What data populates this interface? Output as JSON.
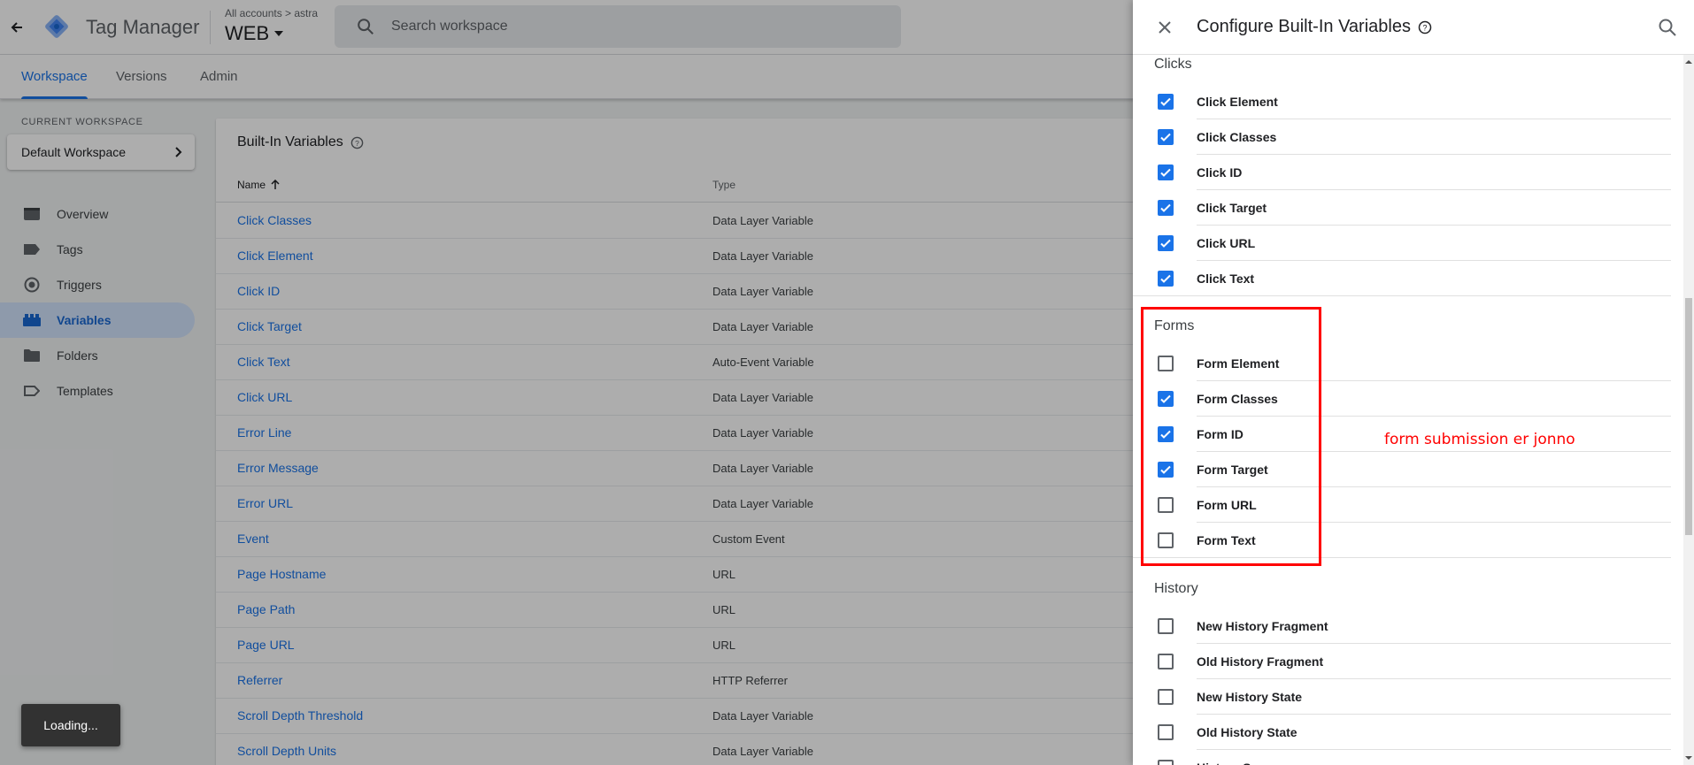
{
  "app": {
    "name": "Tag Manager",
    "breadcrumb": "All accounts > astra",
    "container": "WEB",
    "search_placeholder": "Search workspace"
  },
  "subnav": {
    "tabs": [
      {
        "label": "Workspace",
        "active": true
      },
      {
        "label": "Versions",
        "active": false
      },
      {
        "label": "Admin",
        "active": false
      }
    ]
  },
  "sidebar": {
    "current_workspace_label": "CURRENT WORKSPACE",
    "workspace_name": "Default Workspace",
    "items": [
      {
        "label": "Overview",
        "icon": "overview-icon"
      },
      {
        "label": "Tags",
        "icon": "tag-icon"
      },
      {
        "label": "Triggers",
        "icon": "trigger-icon"
      },
      {
        "label": "Variables",
        "icon": "variables-icon",
        "active": true
      },
      {
        "label": "Folders",
        "icon": "folder-icon"
      },
      {
        "label": "Templates",
        "icon": "template-icon"
      }
    ]
  },
  "main": {
    "title": "Built-In Variables",
    "col_name": "Name",
    "col_type": "Type",
    "rows": [
      {
        "name": "Click Classes",
        "type": "Data Layer Variable"
      },
      {
        "name": "Click Element",
        "type": "Data Layer Variable"
      },
      {
        "name": "Click ID",
        "type": "Data Layer Variable"
      },
      {
        "name": "Click Target",
        "type": "Data Layer Variable"
      },
      {
        "name": "Click Text",
        "type": "Auto-Event Variable"
      },
      {
        "name": "Click URL",
        "type": "Data Layer Variable"
      },
      {
        "name": "Error Line",
        "type": "Data Layer Variable"
      },
      {
        "name": "Error Message",
        "type": "Data Layer Variable"
      },
      {
        "name": "Error URL",
        "type": "Data Layer Variable"
      },
      {
        "name": "Event",
        "type": "Custom Event"
      },
      {
        "name": "Page Hostname",
        "type": "URL"
      },
      {
        "name": "Page Path",
        "type": "URL"
      },
      {
        "name": "Page URL",
        "type": "URL"
      },
      {
        "name": "Referrer",
        "type": "HTTP Referrer"
      },
      {
        "name": "Scroll Depth Threshold",
        "type": "Data Layer Variable"
      },
      {
        "name": "Scroll Depth Units",
        "type": "Data Layer Variable"
      }
    ]
  },
  "toast": "Loading...",
  "drawer": {
    "title": "Configure Built-In Variables",
    "sections": [
      {
        "title": "Clicks",
        "items": [
          {
            "label": "Click Element",
            "checked": true
          },
          {
            "label": "Click Classes",
            "checked": true
          },
          {
            "label": "Click ID",
            "checked": true
          },
          {
            "label": "Click Target",
            "checked": true
          },
          {
            "label": "Click URL",
            "checked": true
          },
          {
            "label": "Click Text",
            "checked": true
          }
        ]
      },
      {
        "title": "Forms",
        "items": [
          {
            "label": "Form Element",
            "checked": false
          },
          {
            "label": "Form Classes",
            "checked": true
          },
          {
            "label": "Form ID",
            "checked": true
          },
          {
            "label": "Form Target",
            "checked": true
          },
          {
            "label": "Form URL",
            "checked": false
          },
          {
            "label": "Form Text",
            "checked": false
          }
        ]
      },
      {
        "title": "History",
        "items": [
          {
            "label": "New History Fragment",
            "checked": false
          },
          {
            "label": "Old History Fragment",
            "checked": false
          },
          {
            "label": "New History State",
            "checked": false
          },
          {
            "label": "Old History State",
            "checked": false
          },
          {
            "label": "History Source",
            "checked": false
          }
        ]
      }
    ]
  },
  "annotation": "form submission er jonno",
  "colors": {
    "accent": "#1a73e8",
    "annotation": "#ff0000",
    "active_nav_bg": "#d2e3fc"
  }
}
